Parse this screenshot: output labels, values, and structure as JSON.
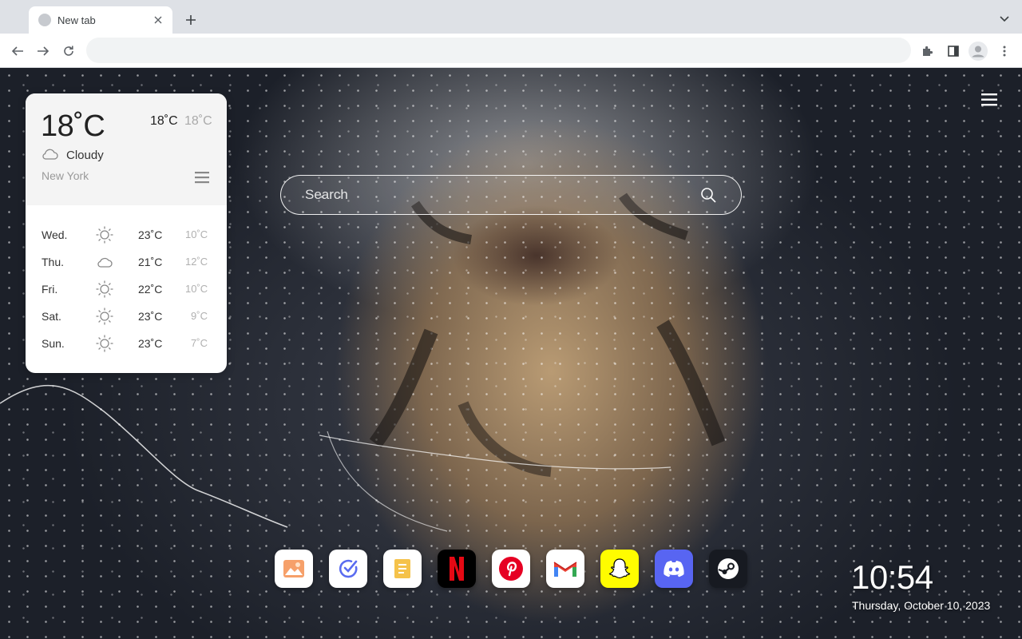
{
  "browser": {
    "tab_title": "New tab",
    "address_value": "",
    "icons": [
      "close-icon",
      "plus-icon",
      "chevron-down-icon",
      "back-arrow-icon",
      "forward-arrow-icon",
      "reload-icon",
      "puzzle-icon",
      "side-panel-icon",
      "profile-icon",
      "more-vert-icon"
    ]
  },
  "weather": {
    "temperature": "18˚C",
    "high": "18˚C",
    "low": "18˚C",
    "condition": "Cloudy",
    "condition_icon": "cloud-icon",
    "city": "New York",
    "forecast": [
      {
        "day": "Wed.",
        "icon": "sun-icon",
        "high": "23˚C",
        "low": "10˚C"
      },
      {
        "day": "Thu.",
        "icon": "cloud-icon",
        "high": "21˚C",
        "low": "12˚C"
      },
      {
        "day": "Fri.",
        "icon": "sun-icon",
        "high": "22˚C",
        "low": "10˚C"
      },
      {
        "day": "Sat.",
        "icon": "sun-icon",
        "high": "23˚C",
        "low": "9˚C"
      },
      {
        "day": "Sun.",
        "icon": "sun-icon",
        "high": "23˚C",
        "low": "7˚C"
      }
    ]
  },
  "search": {
    "placeholder": "Search"
  },
  "dock": [
    {
      "name": "photos",
      "icon": "image-icon",
      "color": "#ffffff"
    },
    {
      "name": "tasks",
      "icon": "check-circle-icon",
      "color": "#ffffff"
    },
    {
      "name": "notes",
      "icon": "note-icon",
      "color": "#ffffff"
    },
    {
      "name": "netflix",
      "icon": "netflix-icon",
      "color": "#000000"
    },
    {
      "name": "pinterest",
      "icon": "pinterest-icon",
      "color": "#ffffff"
    },
    {
      "name": "gmail",
      "icon": "gmail-icon",
      "color": "#ffffff"
    },
    {
      "name": "snapchat",
      "icon": "snapchat-icon",
      "color": "#fffc00"
    },
    {
      "name": "discord",
      "icon": "discord-icon",
      "color": "#5865f2"
    },
    {
      "name": "steam",
      "icon": "steam-icon",
      "color": "#171a21"
    }
  ],
  "clock": {
    "time": "10:54",
    "date": "Thursday, October 10, 2023"
  }
}
